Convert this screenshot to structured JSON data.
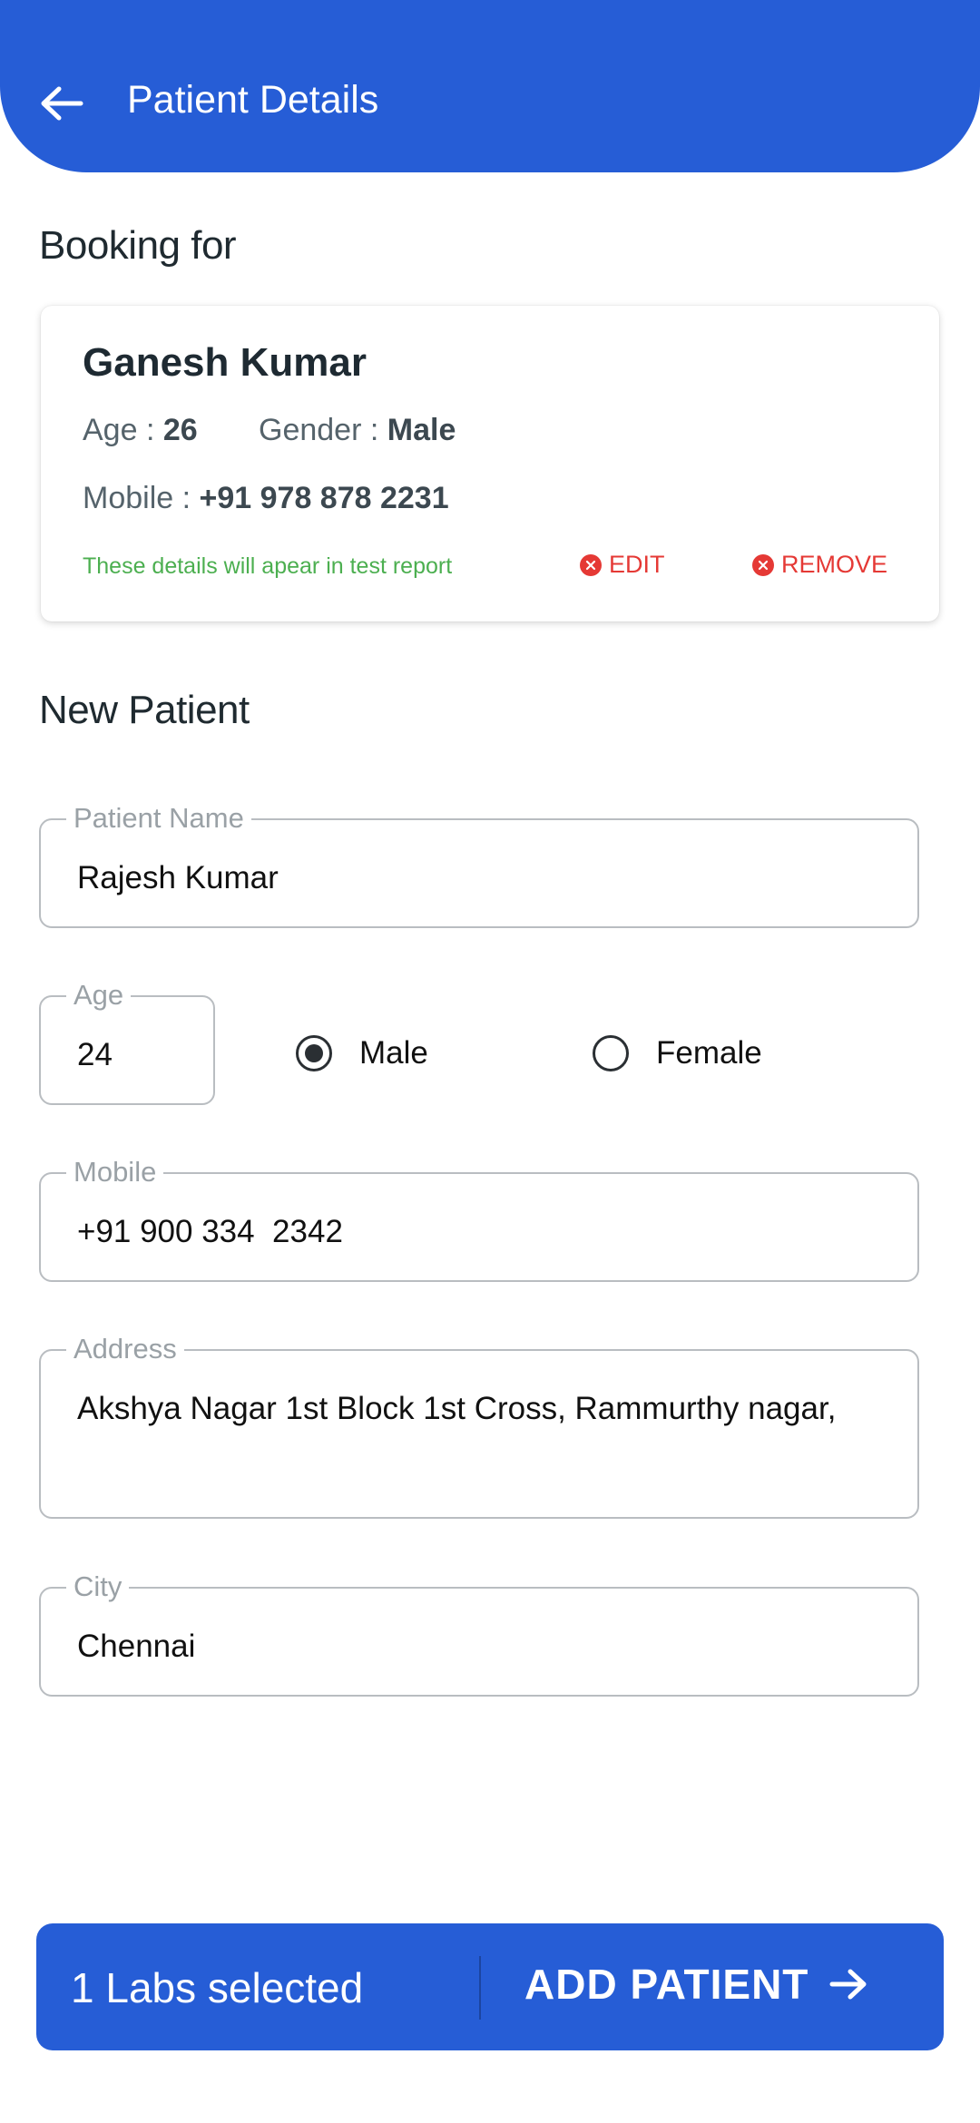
{
  "header": {
    "title": "Patient Details",
    "back_icon": "arrow-left-icon"
  },
  "booking": {
    "section_title": "Booking for",
    "name": "Ganesh Kumar",
    "age_label": "Age :",
    "age": "26",
    "gender_label": "Gender :",
    "gender": "Male",
    "mobile_label": "Mobile :",
    "mobile": "+91 978 878 2231",
    "note": "These details will apear in test report",
    "edit_label": "EDIT",
    "remove_label": "REMOVE",
    "action_color": "#E53935",
    "note_color": "#4CAF50"
  },
  "new_patient": {
    "section_title": "New Patient",
    "name_label": "Patient Name",
    "name_value": "Rajesh Kumar",
    "age_label": "Age",
    "age_value": "24",
    "gender_options": [
      {
        "label": "Male",
        "selected": true
      },
      {
        "label": "Female",
        "selected": false
      }
    ],
    "mobile_label": "Mobile",
    "mobile_value": "+91 900 334  2342",
    "address_label": "Address",
    "address_value": "Akshya Nagar 1st Block 1st Cross, Rammurthy nagar,",
    "city_label": "City",
    "city_value": "Chennai"
  },
  "footer": {
    "labs_selected": "1 Labs selected",
    "add_patient": "ADD PATIENT",
    "arrow_icon": "arrow-right-icon",
    "brand_color": "#265DD6"
  }
}
